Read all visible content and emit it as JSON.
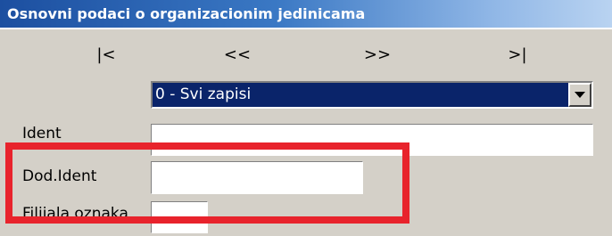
{
  "window": {
    "title": "Osnovni podaci o organizacionim jedinicama"
  },
  "navigation": {
    "first": "|<",
    "prev": "<<",
    "next": ">>",
    "last": ">|"
  },
  "filter": {
    "selected": "0 - Svi zapisi"
  },
  "form": {
    "ident": {
      "label": "Ident",
      "value": ""
    },
    "dod_ident": {
      "label": "Dod.Ident",
      "value": ""
    },
    "filijala": {
      "label": "Filijala oznaka",
      "value": ""
    }
  },
  "colors": {
    "highlight": "#e8232c",
    "title_gradient_start": "#1c4fa0",
    "selection": "#0a246a",
    "background": "#d4d0c8"
  }
}
